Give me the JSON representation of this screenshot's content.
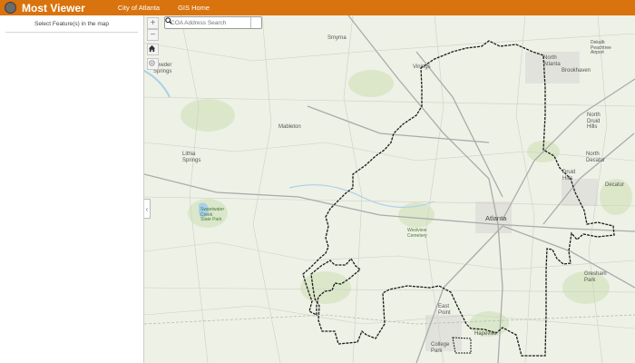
{
  "header": {
    "title": "Most Viewer",
    "nav_links": [
      "City of Atlanta",
      "GIS Home"
    ]
  },
  "sidebar": {
    "message": "Select Feature(s) in the map"
  },
  "map": {
    "search_placeholder": "COA Address Search",
    "zoom_in": "+",
    "zoom_out": "−",
    "labels": {
      "smyrna": "Smyrna",
      "vinings": "Vinings",
      "north_atlanta": "North\nAtlanta",
      "brookhaven": "Brookhaven",
      "dekalb_airport": "Dekalb\nPeachtree\nAirport",
      "powder_springs": "Powder\nSprings",
      "mableton": "Mableton",
      "north_druid_hills": "North\nDruid\nHills",
      "north_decatur": "North\nDecatur",
      "lithia_springs": "Lithia\nSprings",
      "druid_hills": "Druid\nHills",
      "decatur": "Decatur",
      "sweetwater": "Sweetwater\nCreek\nState Park",
      "atlanta": "Atlanta",
      "westview": "Westview\nCemetery",
      "gresham_park": "Gresham\nPark",
      "east_point": "East\nPoint",
      "hapeville": "Hapeville",
      "college_park": "College\nPark"
    }
  },
  "colors": {
    "header": "#d9730d",
    "boundary": "#1a1a1a",
    "map_bg": "#eef1e6"
  }
}
